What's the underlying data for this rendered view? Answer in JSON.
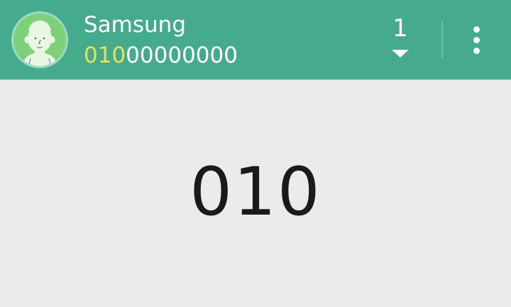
{
  "header": {
    "contact": {
      "name": "Samsung",
      "number_match": "010",
      "number_rest": "00000000",
      "avatar_icon": "person-icon"
    },
    "match_count": "1",
    "expand_icon": "caret-down-icon",
    "menu_icon": "more-vertical-icon"
  },
  "dialer": {
    "entered_number": "010"
  },
  "colors": {
    "header_bg": "#45ab8c",
    "match_highlight": "#e6e15a",
    "background": "#ebebeb",
    "text_dark": "#1a1a1a"
  }
}
